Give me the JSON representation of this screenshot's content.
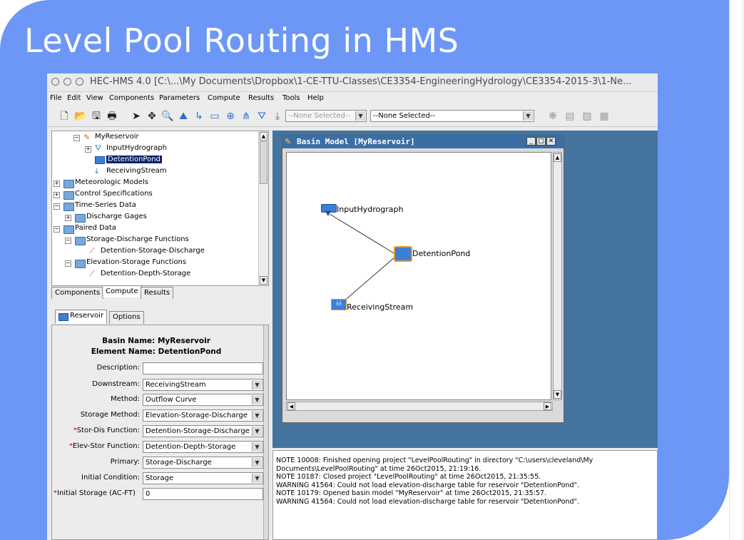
{
  "slide": {
    "title": "Level Pool Routing in HMS"
  },
  "window": {
    "title": "HEC-HMS 4.0 [C:\\...\\My Documents\\Dropbox\\1-CE-TTU-Classes\\CE3354-EngineeringHydrology\\CE3354-2015-3\\1-Ne..."
  },
  "menu": [
    "File",
    "Edit",
    "View",
    "Components",
    "Parameters",
    "Compute",
    "Results",
    "Tools",
    "Help"
  ],
  "toolbar": {
    "selector1": "--None Selected--",
    "selector2": "--None Selected--"
  },
  "tree": {
    "items": [
      "MyReservoir",
      "InputHydrograph",
      "DetentionPond",
      "ReceivingStream",
      "Meteorologic Models",
      "Control Specifications",
      "Time-Series Data",
      "Discharge Gages",
      "Paired Data",
      "Storage-Discharge Functions",
      "Detention-Storage-Discharge",
      "Elevation-Storage Functions",
      "Detention-Depth-Storage"
    ],
    "selected": "DetentionPond"
  },
  "nav_tabs": [
    "Components",
    "Compute",
    "Results"
  ],
  "editor": {
    "tabs": [
      "Reservoir",
      "Options"
    ],
    "basin_name": "Basin Name: MyReservoir",
    "element_name": "Element Name: DetentionPond",
    "fields": {
      "description": {
        "label": "Description:",
        "value": ""
      },
      "downstream": {
        "label": "Downstream:",
        "value": "ReceivingStream"
      },
      "method": {
        "label": "Method:",
        "value": "Outflow Curve"
      },
      "storage_method": {
        "label": "Storage Method:",
        "value": "Elevation-Storage-Discharge"
      },
      "stor_dis": {
        "label": "Stor-Dis Function:",
        "value": "Detention-Storage-Discharge",
        "required": "*"
      },
      "elev_stor": {
        "label": "Elev-Stor Function:",
        "value": "Detention-Depth-Storage",
        "required": "*"
      },
      "primary": {
        "label": "Primary:",
        "value": "Storage-Discharge"
      },
      "initial_condition": {
        "label": "Initial Condition:",
        "value": "Storage"
      },
      "initial_storage": {
        "label": "Initial Storage (AC-FT)",
        "value": "0",
        "required": "*"
      }
    }
  },
  "basin": {
    "title": "Basin Model [MyReservoir]",
    "elements": [
      "InputHydrograph",
      "DetentionPond",
      "ReceivingStream"
    ]
  },
  "log": [
    "NOTE 10008:  Finished opening project \"LevelPoolRouting\" in directory \"C:\\users\\cleveland\\My",
    "Documents\\LevelPoolRouting\" at time 26Oct2015, 21:19:16.",
    "NOTE 10187:  Closed project \"LevelPoolRouting\" at time 26Oct2015, 21:35:55.",
    "WARNING 41564:  Could not load elevation-discharge table for reservoir \"DetentionPond\".",
    "NOTE 10179:  Opened basin model \"MyReservoir\" at time 26Oct2015, 21:35:57.",
    "WARNING 41564:  Could not load elevation-discharge table for reservoir \"DetentionPond\"."
  ],
  "colors": {
    "slide_bg": "#6c97f6",
    "desktop": "#45749f",
    "title_active": "#3a6ea5",
    "selection": "#0a246a"
  }
}
